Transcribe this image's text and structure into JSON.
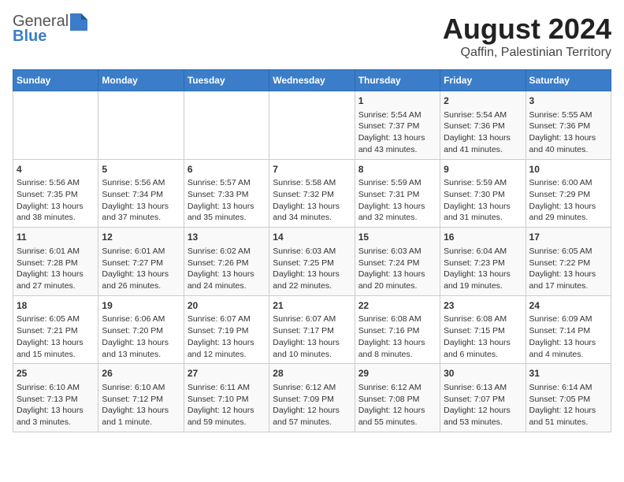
{
  "header": {
    "logo_general": "General",
    "logo_blue": "Blue",
    "title": "August 2024",
    "subtitle": "Qaffin, Palestinian Territory"
  },
  "calendar": {
    "days_of_week": [
      "Sunday",
      "Monday",
      "Tuesday",
      "Wednesday",
      "Thursday",
      "Friday",
      "Saturday"
    ],
    "weeks": [
      [
        {
          "day": "",
          "info": ""
        },
        {
          "day": "",
          "info": ""
        },
        {
          "day": "",
          "info": ""
        },
        {
          "day": "",
          "info": ""
        },
        {
          "day": "1",
          "info": "Sunrise: 5:54 AM\nSunset: 7:37 PM\nDaylight: 13 hours\nand 43 minutes."
        },
        {
          "day": "2",
          "info": "Sunrise: 5:54 AM\nSunset: 7:36 PM\nDaylight: 13 hours\nand 41 minutes."
        },
        {
          "day": "3",
          "info": "Sunrise: 5:55 AM\nSunset: 7:36 PM\nDaylight: 13 hours\nand 40 minutes."
        }
      ],
      [
        {
          "day": "4",
          "info": "Sunrise: 5:56 AM\nSunset: 7:35 PM\nDaylight: 13 hours\nand 38 minutes."
        },
        {
          "day": "5",
          "info": "Sunrise: 5:56 AM\nSunset: 7:34 PM\nDaylight: 13 hours\nand 37 minutes."
        },
        {
          "day": "6",
          "info": "Sunrise: 5:57 AM\nSunset: 7:33 PM\nDaylight: 13 hours\nand 35 minutes."
        },
        {
          "day": "7",
          "info": "Sunrise: 5:58 AM\nSunset: 7:32 PM\nDaylight: 13 hours\nand 34 minutes."
        },
        {
          "day": "8",
          "info": "Sunrise: 5:59 AM\nSunset: 7:31 PM\nDaylight: 13 hours\nand 32 minutes."
        },
        {
          "day": "9",
          "info": "Sunrise: 5:59 AM\nSunset: 7:30 PM\nDaylight: 13 hours\nand 31 minutes."
        },
        {
          "day": "10",
          "info": "Sunrise: 6:00 AM\nSunset: 7:29 PM\nDaylight: 13 hours\nand 29 minutes."
        }
      ],
      [
        {
          "day": "11",
          "info": "Sunrise: 6:01 AM\nSunset: 7:28 PM\nDaylight: 13 hours\nand 27 minutes."
        },
        {
          "day": "12",
          "info": "Sunrise: 6:01 AM\nSunset: 7:27 PM\nDaylight: 13 hours\nand 26 minutes."
        },
        {
          "day": "13",
          "info": "Sunrise: 6:02 AM\nSunset: 7:26 PM\nDaylight: 13 hours\nand 24 minutes."
        },
        {
          "day": "14",
          "info": "Sunrise: 6:03 AM\nSunset: 7:25 PM\nDaylight: 13 hours\nand 22 minutes."
        },
        {
          "day": "15",
          "info": "Sunrise: 6:03 AM\nSunset: 7:24 PM\nDaylight: 13 hours\nand 20 minutes."
        },
        {
          "day": "16",
          "info": "Sunrise: 6:04 AM\nSunset: 7:23 PM\nDaylight: 13 hours\nand 19 minutes."
        },
        {
          "day": "17",
          "info": "Sunrise: 6:05 AM\nSunset: 7:22 PM\nDaylight: 13 hours\nand 17 minutes."
        }
      ],
      [
        {
          "day": "18",
          "info": "Sunrise: 6:05 AM\nSunset: 7:21 PM\nDaylight: 13 hours\nand 15 minutes."
        },
        {
          "day": "19",
          "info": "Sunrise: 6:06 AM\nSunset: 7:20 PM\nDaylight: 13 hours\nand 13 minutes."
        },
        {
          "day": "20",
          "info": "Sunrise: 6:07 AM\nSunset: 7:19 PM\nDaylight: 13 hours\nand 12 minutes."
        },
        {
          "day": "21",
          "info": "Sunrise: 6:07 AM\nSunset: 7:17 PM\nDaylight: 13 hours\nand 10 minutes."
        },
        {
          "day": "22",
          "info": "Sunrise: 6:08 AM\nSunset: 7:16 PM\nDaylight: 13 hours\nand 8 minutes."
        },
        {
          "day": "23",
          "info": "Sunrise: 6:08 AM\nSunset: 7:15 PM\nDaylight: 13 hours\nand 6 minutes."
        },
        {
          "day": "24",
          "info": "Sunrise: 6:09 AM\nSunset: 7:14 PM\nDaylight: 13 hours\nand 4 minutes."
        }
      ],
      [
        {
          "day": "25",
          "info": "Sunrise: 6:10 AM\nSunset: 7:13 PM\nDaylight: 13 hours\nand 3 minutes."
        },
        {
          "day": "26",
          "info": "Sunrise: 6:10 AM\nSunset: 7:12 PM\nDaylight: 13 hours\nand 1 minute."
        },
        {
          "day": "27",
          "info": "Sunrise: 6:11 AM\nSunset: 7:10 PM\nDaylight: 12 hours\nand 59 minutes."
        },
        {
          "day": "28",
          "info": "Sunrise: 6:12 AM\nSunset: 7:09 PM\nDaylight: 12 hours\nand 57 minutes."
        },
        {
          "day": "29",
          "info": "Sunrise: 6:12 AM\nSunset: 7:08 PM\nDaylight: 12 hours\nand 55 minutes."
        },
        {
          "day": "30",
          "info": "Sunrise: 6:13 AM\nSunset: 7:07 PM\nDaylight: 12 hours\nand 53 minutes."
        },
        {
          "day": "31",
          "info": "Sunrise: 6:14 AM\nSunset: 7:05 PM\nDaylight: 12 hours\nand 51 minutes."
        }
      ]
    ]
  }
}
